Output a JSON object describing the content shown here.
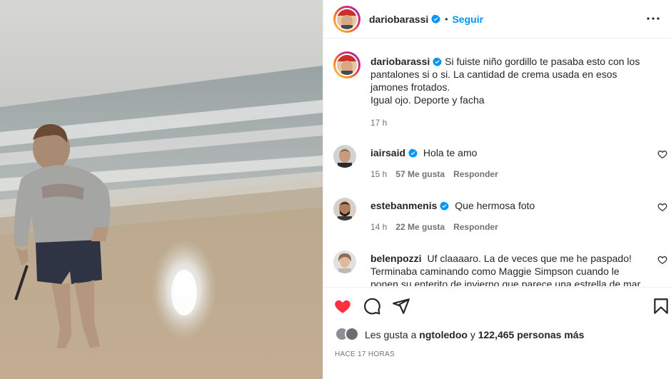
{
  "post": {
    "username": "dariobarassi",
    "separator": "•",
    "follow_label": "Seguir"
  },
  "caption": {
    "username": "dariobarassi",
    "text": "Si fuiste niño gordillo te pasaba esto con los pantalones si o si. La cantidad de crema usada en esos jamones frotados.",
    "text2": "Igual ojo. Deporte y facha",
    "time": "17 h"
  },
  "comments": [
    {
      "username": "iairsaid",
      "verified": true,
      "text": "Hola te amo",
      "time": "15 h",
      "likes": "57 Me gusta",
      "reply": "Responder"
    },
    {
      "username": "estebanmenis",
      "verified": true,
      "text": "Que hermosa foto",
      "time": "14 h",
      "likes": "22 Me gusta",
      "reply": "Responder"
    },
    {
      "username": "belenpozzi",
      "verified": false,
      "text": "Uf claaaaro. La de veces que me he paspado! Terminaba caminando como Maggie Simpson cuando le ponen su enterito de invierno que parece una estrella de mar 😆😆"
    }
  ],
  "likes": {
    "prefix": "Les gusta a",
    "liker": "ngtoledoo",
    "connector": "y",
    "count": "122,465",
    "suffix": "personas más"
  },
  "time_ago": "HACE 17 HORAS",
  "colors": {
    "accent": "#0095f6",
    "like_red": "#ff3040",
    "verified_blue": "#0095f6",
    "muted": "#737373"
  },
  "icons": [
    "more-options-icon",
    "verified-icon",
    "heart-icon",
    "comment-icon",
    "share-icon",
    "bookmark-icon"
  ]
}
